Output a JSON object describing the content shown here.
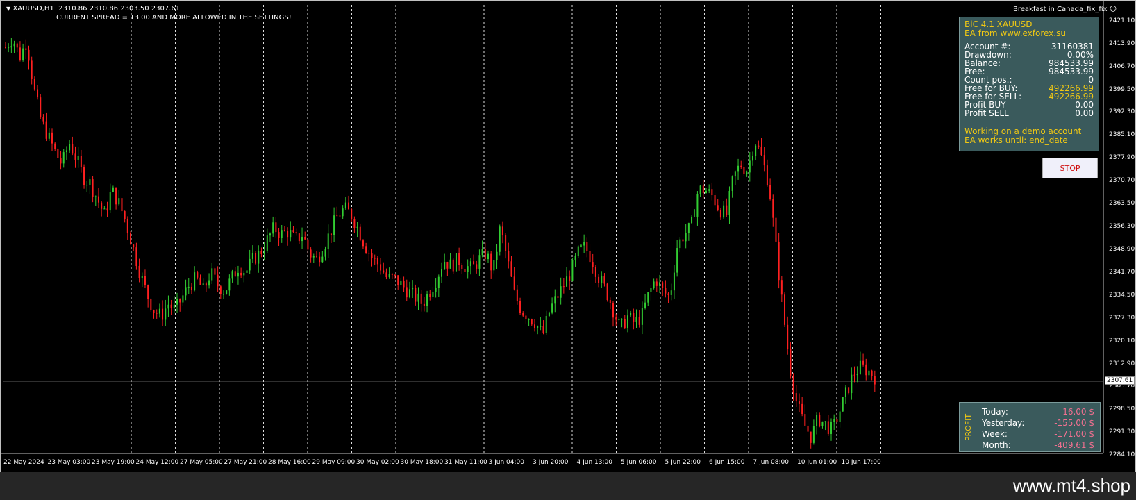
{
  "header": {
    "symbol": "XAUUSD,H1",
    "ohlc": "2310.86 2310.86 2303.50 2307.61",
    "spread_msg": "CURRENT SPREAD = 13.00 AND MORE ALLOWED IN THE SETTINGS!",
    "ea_name": "Breakfast in Canada_fix_fix",
    "smiley": "☺",
    "dropdown_icon": "triangle-down-icon"
  },
  "chart_data": {
    "type": "candlestick",
    "symbol": "XAUUSD",
    "timeframe": "H1",
    "current_price": 2307.61,
    "ylim": [
      2284.1,
      2421.1
    ],
    "price_ticks": [
      "2421.10",
      "2413.90",
      "2406.70",
      "2399.50",
      "2392.30",
      "2385.10",
      "2377.90",
      "2370.70",
      "2363.50",
      "2356.30",
      "2348.90",
      "2341.70",
      "2334.50",
      "2327.30",
      "2320.10",
      "2312.90",
      "2305.70",
      "2298.50",
      "2291.30",
      "2284.10"
    ],
    "time_ticks": [
      "22 May 2024",
      "23 May 03:00",
      "23 May 19:00",
      "24 May 12:00",
      "27 May 05:00",
      "27 May 21:00",
      "28 May 16:00",
      "29 May 09:00",
      "30 May 02:00",
      "30 May 18:00",
      "31 May 11:00",
      "3 Jun 04:00",
      "3 Jun 20:00",
      "4 Jun 13:00",
      "5 Jun 06:00",
      "5 Jun 22:00",
      "6 Jun 15:00",
      "7 Jun 08:00",
      "10 Jun 01:00",
      "10 Jun 17:00"
    ],
    "path_close": [
      2413,
      2416,
      2410,
      2415,
      2400,
      2390,
      2385,
      2380,
      2376,
      2383,
      2378,
      2372,
      2370,
      2365,
      2360,
      2368,
      2364,
      2358,
      2350,
      2342,
      2335,
      2330,
      2328,
      2332,
      2330,
      2334,
      2338,
      2340,
      2336,
      2342,
      2338,
      2336,
      2340,
      2344,
      2342,
      2346,
      2348,
      2352,
      2356,
      2354,
      2355,
      2352,
      2354,
      2348,
      2346,
      2350,
      2355,
      2360,
      2362,
      2360,
      2355,
      2350,
      2346,
      2344,
      2340,
      2340,
      2338,
      2336,
      2334,
      2332,
      2336,
      2340,
      2346,
      2344,
      2346,
      2344,
      2343,
      2346,
      2348,
      2342,
      2356,
      2346,
      2335,
      2330,
      2328,
      2326,
      2322,
      2330,
      2334,
      2338,
      2342,
      2348,
      2350,
      2346,
      2340,
      2336,
      2330,
      2324,
      2328,
      2326,
      2328,
      2335,
      2340,
      2336,
      2334,
      2350,
      2354,
      2356,
      2368,
      2368,
      2366,
      2362,
      2360,
      2372,
      2376,
      2374,
      2384,
      2378,
      2370,
      2350,
      2330,
      2312,
      2300,
      2294,
      2290,
      2296,
      2294,
      2292,
      2298,
      2304,
      2310,
      2312,
      2311,
      2309
    ]
  },
  "info_panel": {
    "title1": "BiC 4.1 XAUUSD",
    "title2": "EA from www.exforex.su",
    "rows": [
      {
        "label": "Account #:",
        "value": "31160381",
        "yellow": false
      },
      {
        "label": "Drawdown:",
        "value": "0.00%",
        "yellow": false
      },
      {
        "label": "Balance:",
        "value": "984533.99",
        "yellow": false
      },
      {
        "label": "Free:",
        "value": "984533.99",
        "yellow": false
      },
      {
        "label": "Count pos.:",
        "value": "0",
        "yellow": false
      },
      {
        "label": "Free for BUY:",
        "value": "492266.99",
        "yellow": true
      },
      {
        "label": "Free for SELL:",
        "value": "492266.99",
        "yellow": true
      },
      {
        "label": "Profit BUY",
        "value": "0.00",
        "yellow": false
      },
      {
        "label": "Profit SELL",
        "value": "0.00",
        "yellow": false
      }
    ],
    "note1": "Working on a demo account",
    "note2": "EA works until: end_date"
  },
  "stop_button": {
    "label": "STOP"
  },
  "profit_panel": {
    "vertical_label": "PROFIT",
    "rows": [
      {
        "label": "Today:",
        "value": "-16.00 $"
      },
      {
        "label": "Yesterday:",
        "value": "-155.00 $"
      },
      {
        "label": "Week:",
        "value": "-171.00 $"
      },
      {
        "label": "Month:",
        "value": "-409.61 $"
      }
    ]
  },
  "colors": {
    "bull": "#32cd32",
    "bear": "#ff2020",
    "panel": "#3a5a5c",
    "accent": "#f0c814",
    "loss": "#f07090"
  },
  "footer": {
    "site": "www.mt4.shop"
  }
}
